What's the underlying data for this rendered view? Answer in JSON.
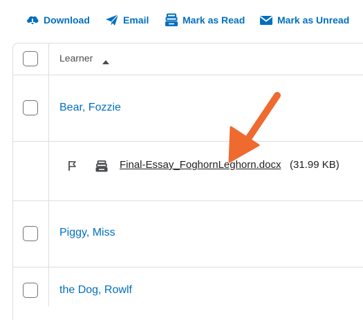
{
  "toolbar": {
    "download_label": "Download",
    "email_label": "Email",
    "mark_read_label": "Mark as Read",
    "mark_unread_label": "Mark as Unread"
  },
  "table": {
    "column_header": "Learner",
    "sort_direction": "ascending",
    "rows": [
      {
        "learner": "Bear, Fozzie"
      },
      {
        "learner": "Piggy, Miss"
      },
      {
        "learner": "the Dog, Rowlf"
      }
    ],
    "submission": {
      "file_name": "Final-Essay_FoghornLeghorn.docx",
      "file_size": "(31.99 KB)"
    }
  },
  "colors": {
    "accent": "#006fbf",
    "annotation_arrow": "#ee6a2f",
    "border": "#dcdee2"
  },
  "icons": [
    "download-icon",
    "email-icon",
    "mark-read-icon",
    "mark-unread-icon",
    "sort-ascending-icon",
    "flag-icon",
    "submission-icon"
  ]
}
